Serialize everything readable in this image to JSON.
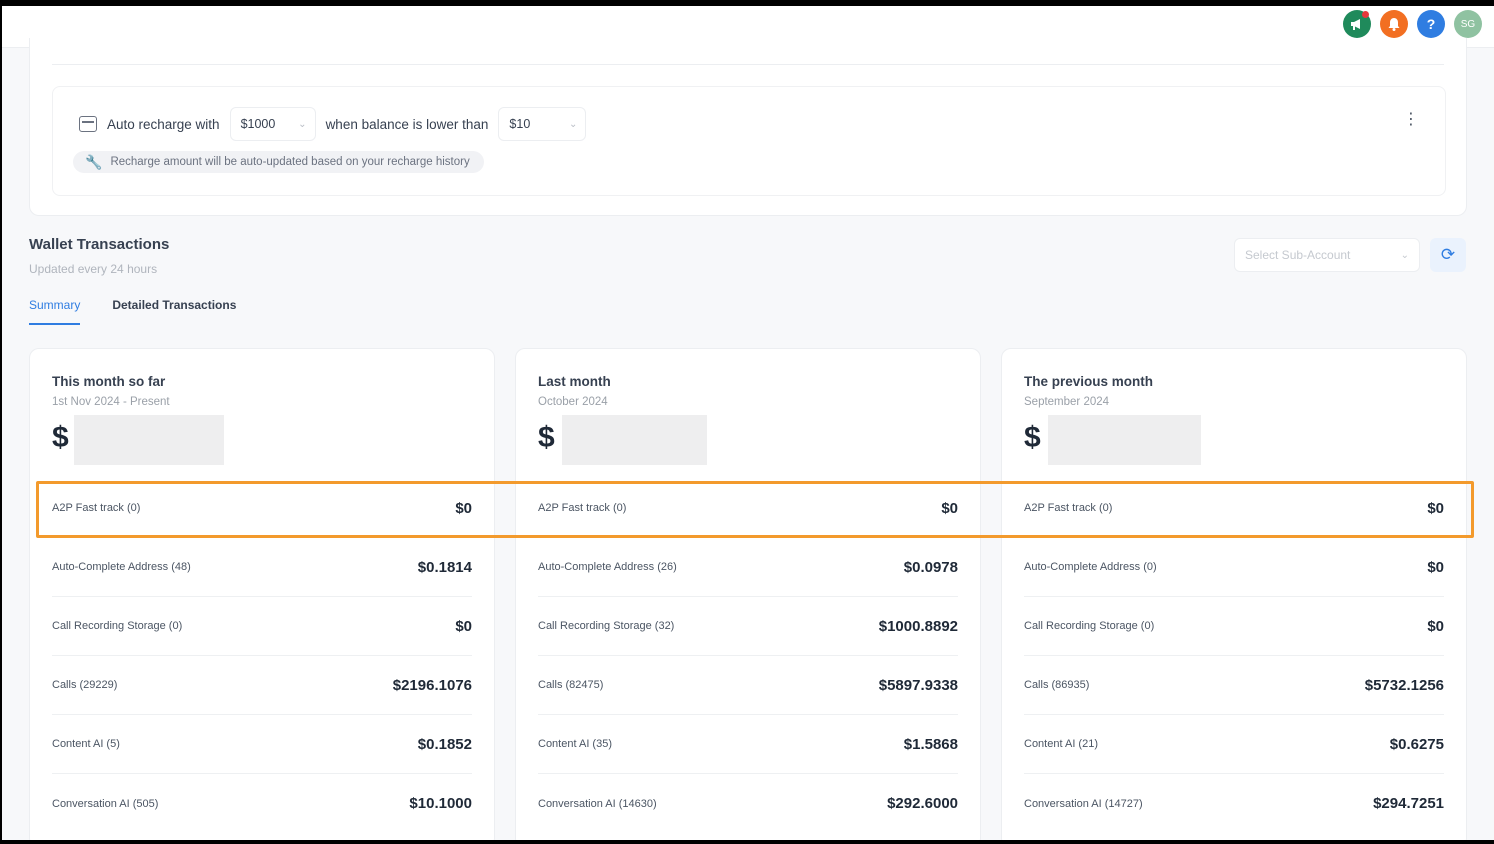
{
  "header": {
    "icons": [
      "megaphone-icon",
      "bell-icon",
      "help-icon",
      "avatar"
    ],
    "avatar_initials": "SG",
    "help_glyph": "?"
  },
  "recharge": {
    "label_prefix": "Auto recharge with",
    "amount": "$1000",
    "label_middle": "when balance is lower than",
    "threshold": "$10",
    "note": "Recharge amount will be auto-updated based on your recharge history"
  },
  "wallet": {
    "title": "Wallet Transactions",
    "subtitle": "Updated every 24 hours",
    "subaccount_placeholder": "Select Sub-Account",
    "tabs": [
      {
        "label": "Summary",
        "active": true
      },
      {
        "label": "Detailed Transactions",
        "active": false
      }
    ]
  },
  "periods": [
    {
      "title": "This month so far",
      "subtitle": "1st Nov 2024 - Present",
      "currency": "$",
      "rows": [
        {
          "label": "A2P Fast track (0)",
          "value": "$0"
        },
        {
          "label": "Auto-Complete Address (48)",
          "value": "$0.1814"
        },
        {
          "label": "Call Recording Storage (0)",
          "value": "$0"
        },
        {
          "label": "Calls (29229)",
          "value": "$2196.1076"
        },
        {
          "label": "Content AI (5)",
          "value": "$0.1852"
        },
        {
          "label": "Conversation AI (505)",
          "value": "$10.1000"
        }
      ]
    },
    {
      "title": "Last month",
      "subtitle": "October 2024",
      "currency": "$",
      "rows": [
        {
          "label": "A2P Fast track (0)",
          "value": "$0"
        },
        {
          "label": "Auto-Complete Address (26)",
          "value": "$0.0978"
        },
        {
          "label": "Call Recording Storage (32)",
          "value": "$1000.8892"
        },
        {
          "label": "Calls (82475)",
          "value": "$5897.9338"
        },
        {
          "label": "Content AI (35)",
          "value": "$1.5868"
        },
        {
          "label": "Conversation AI (14630)",
          "value": "$292.6000"
        }
      ]
    },
    {
      "title": "The previous month",
      "subtitle": "September 2024",
      "currency": "$",
      "rows": [
        {
          "label": "A2P Fast track (0)",
          "value": "$0"
        },
        {
          "label": "Auto-Complete Address (0)",
          "value": "$0"
        },
        {
          "label": "Call Recording Storage (0)",
          "value": "$0"
        },
        {
          "label": "Calls (86935)",
          "value": "$5732.1256"
        },
        {
          "label": "Content AI (21)",
          "value": "$0.6275"
        },
        {
          "label": "Conversation AI (14727)",
          "value": "$294.7251"
        }
      ]
    }
  ],
  "colors": {
    "accent": "#2f7de1",
    "highlight": "#f39a2c",
    "megaphone": "#1f8a5b",
    "bell": "#f26f22"
  }
}
